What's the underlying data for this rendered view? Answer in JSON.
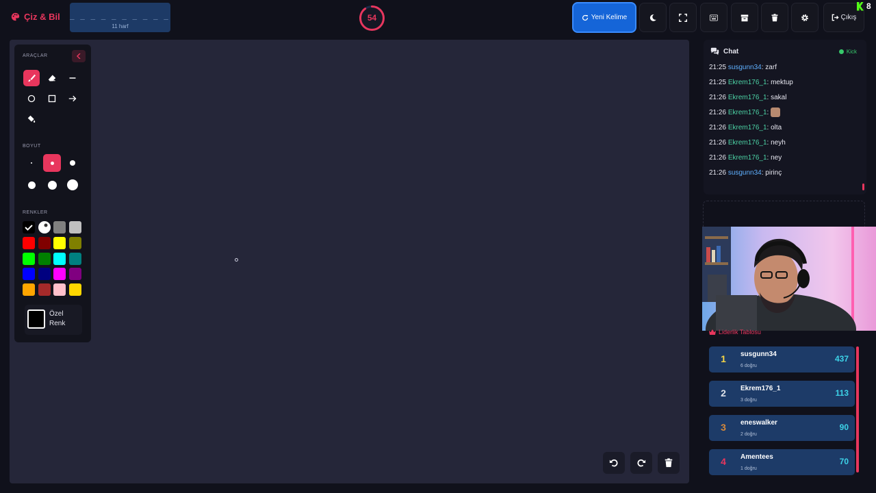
{
  "app": {
    "title": "Çiz & Bil"
  },
  "word": {
    "mask": "_ _ _ _ _ _ _ _ _ _ _",
    "count": "11 harf"
  },
  "timer": {
    "value": "54",
    "progress": 0.9
  },
  "toolbar": {
    "new_word": "Yeni Kelime",
    "exit": "Çıkış",
    "icons": [
      "moon-icon",
      "fullscreen-icon",
      "keyboard-icon",
      "archive-icon",
      "trash-icon",
      "gear-icon"
    ]
  },
  "corner": {
    "count": "8"
  },
  "tools": {
    "section_tools": "ARAÇLAR",
    "section_size": "BOYUT",
    "section_colors": "RENKLER",
    "items": [
      "brush",
      "eraser",
      "line",
      "circle",
      "rectangle",
      "arrow",
      "fill"
    ],
    "active_tool": "brush",
    "sizes": [
      2,
      5,
      8,
      11,
      13,
      16
    ],
    "active_size": 1,
    "colors": [
      "#000000",
      "#ffffff",
      "#808080",
      "#c0c0c0",
      "#ff0000",
      "#800000",
      "#ffff00",
      "#808000",
      "#00ff00",
      "#008000",
      "#00ffff",
      "#008080",
      "#0000ff",
      "#000080",
      "#ff00ff",
      "#800080",
      "#ffa500",
      "#a52a2a",
      "#ffc0cb",
      "#ffd700"
    ],
    "custom_label": "Özel Renk"
  },
  "chat": {
    "title": "Chat",
    "platform": "Kick",
    "messages": [
      {
        "time": "21:25",
        "user": "susgunn34",
        "color": "u1",
        "text": "zarf"
      },
      {
        "time": "21:25",
        "user": "Ekrem176_1",
        "color": "u2",
        "text": "mektup"
      },
      {
        "time": "21:26",
        "user": "Ekrem176_1",
        "color": "u2",
        "text": "sakal"
      },
      {
        "time": "21:26",
        "user": "Ekrem176_1",
        "color": "u2",
        "text": "",
        "emote": true
      },
      {
        "time": "21:26",
        "user": "Ekrem176_1",
        "color": "u2",
        "text": "olta"
      },
      {
        "time": "21:26",
        "user": "Ekrem176_1",
        "color": "u2",
        "text": "neyh"
      },
      {
        "time": "21:26",
        "user": "Ekrem176_1",
        "color": "u2",
        "text": "ney"
      },
      {
        "time": "21:26",
        "user": "susgunn34",
        "color": "u1",
        "text": "pirinç"
      }
    ]
  },
  "leaderboard": {
    "title": "Liderlik Tablosu",
    "rows": [
      {
        "rank": "1",
        "name": "susgunn34",
        "correct": "6 doğru",
        "score": "437",
        "color": "#f5d547"
      },
      {
        "rank": "2",
        "name": "Ekrem176_1",
        "correct": "3 doğru",
        "score": "113",
        "color": "#dfe3ea"
      },
      {
        "rank": "3",
        "name": "eneswalker",
        "correct": "2 doğru",
        "score": "90",
        "color": "#d98a3a"
      },
      {
        "rank": "4",
        "name": "Amentees",
        "correct": "1 doğru",
        "score": "70",
        "color": "#e8365d"
      }
    ]
  }
}
